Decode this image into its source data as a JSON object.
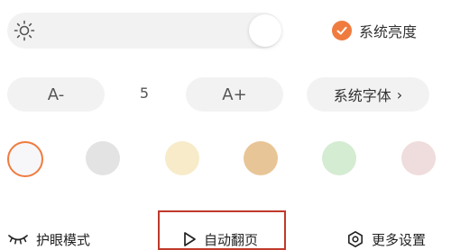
{
  "brightness": {
    "level": 0.95,
    "icon": "sun-icon",
    "system_brightness_label": "系统亮度",
    "system_brightness_checked": true,
    "accent_color": "#f07b3f"
  },
  "font": {
    "decrease_label": "A-",
    "increase_label": "A+",
    "size_value": "5",
    "system_font_label": "系统字体",
    "system_font_chevron": "›"
  },
  "themes": [
    {
      "color": "#f7f7fa",
      "selected": true
    },
    {
      "color": "#e3e3e3",
      "selected": false
    },
    {
      "color": "#f7ebc9",
      "selected": false
    },
    {
      "color": "#e8c596",
      "selected": false
    },
    {
      "color": "#d4ecd2",
      "selected": false
    },
    {
      "color": "#efdcdc",
      "selected": false
    }
  ],
  "bottom_bar": {
    "eye_mode_label": "护眼模式",
    "auto_page_label": "自动翻页",
    "more_settings_label": "更多设置",
    "highlight_color": "#c0392b"
  }
}
